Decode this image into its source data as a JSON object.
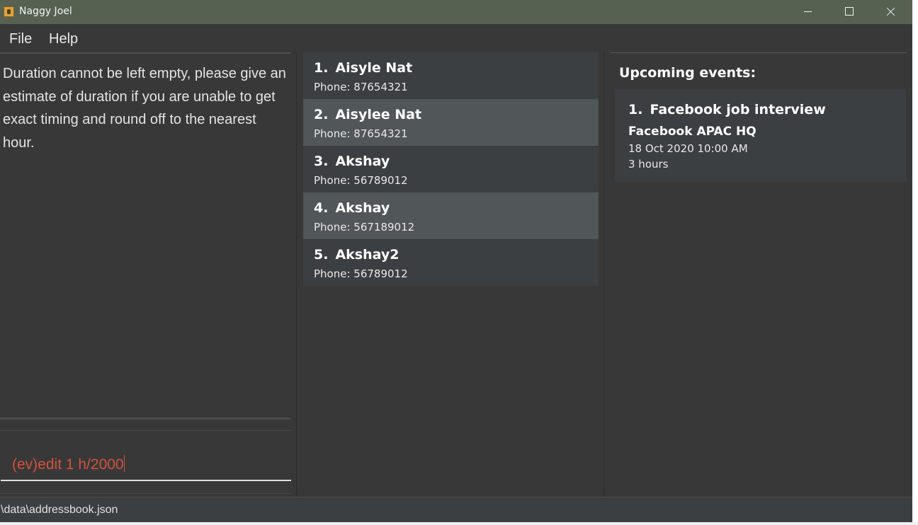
{
  "window": {
    "title": "Naggy Joel",
    "icon": "contacts-book-icon"
  },
  "menu": {
    "items": [
      "File",
      "Help"
    ]
  },
  "result_display": {
    "text": "Duration cannot be left empty, please give an estimate of duration if you are unable to get exact timing and round off to the nearest hour."
  },
  "command_box": {
    "value": "(ev)edit 1 h/2000"
  },
  "persons": [
    {
      "index": "1.",
      "name": "Aisyle Nat",
      "phone": "Phone: 87654321"
    },
    {
      "index": "2.",
      "name": "Aisylee Nat",
      "phone": "Phone: 87654321"
    },
    {
      "index": "3.",
      "name": "Akshay",
      "phone": "Phone: 56789012"
    },
    {
      "index": "4.",
      "name": "Akshay",
      "phone": "Phone: 567189012"
    },
    {
      "index": "5.",
      "name": "Akshay2",
      "phone": "Phone: 56789012"
    }
  ],
  "events": {
    "title": "Upcoming events:",
    "items": [
      {
        "index": "1.",
        "name": "Facebook job interview",
        "location": "Facebook APAC HQ",
        "datetime": "18 Oct 2020 10:00 AM",
        "duration": "3 hours"
      }
    ]
  },
  "status_bar": {
    "path": "\\data\\addressbook.json"
  },
  "colors": {
    "title_bar": "#566152",
    "background": "#383838",
    "card_odd": "#3c3f41",
    "card_even": "#515658",
    "error_text": "#d3523c"
  }
}
